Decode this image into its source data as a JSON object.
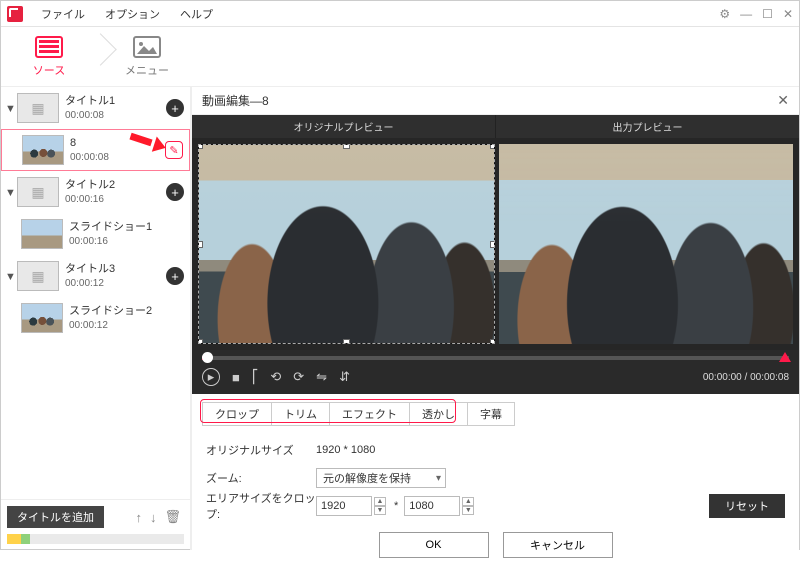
{
  "menubar": {
    "items": [
      "ファイル",
      "オプション",
      "ヘルプ"
    ]
  },
  "window_controls": {
    "gear": "⚙",
    "min": "—",
    "max": "☐",
    "close": "✕"
  },
  "topnav": {
    "tabs": [
      {
        "label": "ソース",
        "active": true
      },
      {
        "label": "メニュー",
        "active": false
      }
    ]
  },
  "sidebar": {
    "titles": [
      {
        "name": "タイトル1",
        "time": "00:00:08",
        "clips": [
          {
            "name": "8",
            "time": "00:00:08",
            "selected": true,
            "has_edit": true
          }
        ]
      },
      {
        "name": "タイトル2",
        "time": "00:00:16",
        "clips": [
          {
            "name": "スライドショー1",
            "time": "00:00:16"
          }
        ]
      },
      {
        "name": "タイトル3",
        "time": "00:00:12",
        "clips": [
          {
            "name": "スライドショー2",
            "time": "00:00:12"
          }
        ]
      }
    ],
    "add_title_label": "タイトルを追加"
  },
  "editor": {
    "header_title": "動画編集—8",
    "preview_labels": {
      "original": "オリジナルプレビュー",
      "output": "出力プレビュー"
    },
    "time_display": "00:00:00 / 00:00:08",
    "tabs": [
      "クロップ",
      "トリム",
      "エフェクト",
      "透かし",
      "字幕"
    ],
    "form": {
      "original_size_label": "オリジナルサイズ",
      "original_size_value": "1920 * 1080",
      "zoom_label": "ズーム:",
      "zoom_value": "元の解像度を保持",
      "crop_label": "エリアサイズをクロップ:",
      "crop_w": "1920",
      "crop_star": "*",
      "crop_h": "1080",
      "reset_label": "リセット"
    },
    "buttons": {
      "ok": "OK",
      "cancel": "キャンセル"
    }
  }
}
